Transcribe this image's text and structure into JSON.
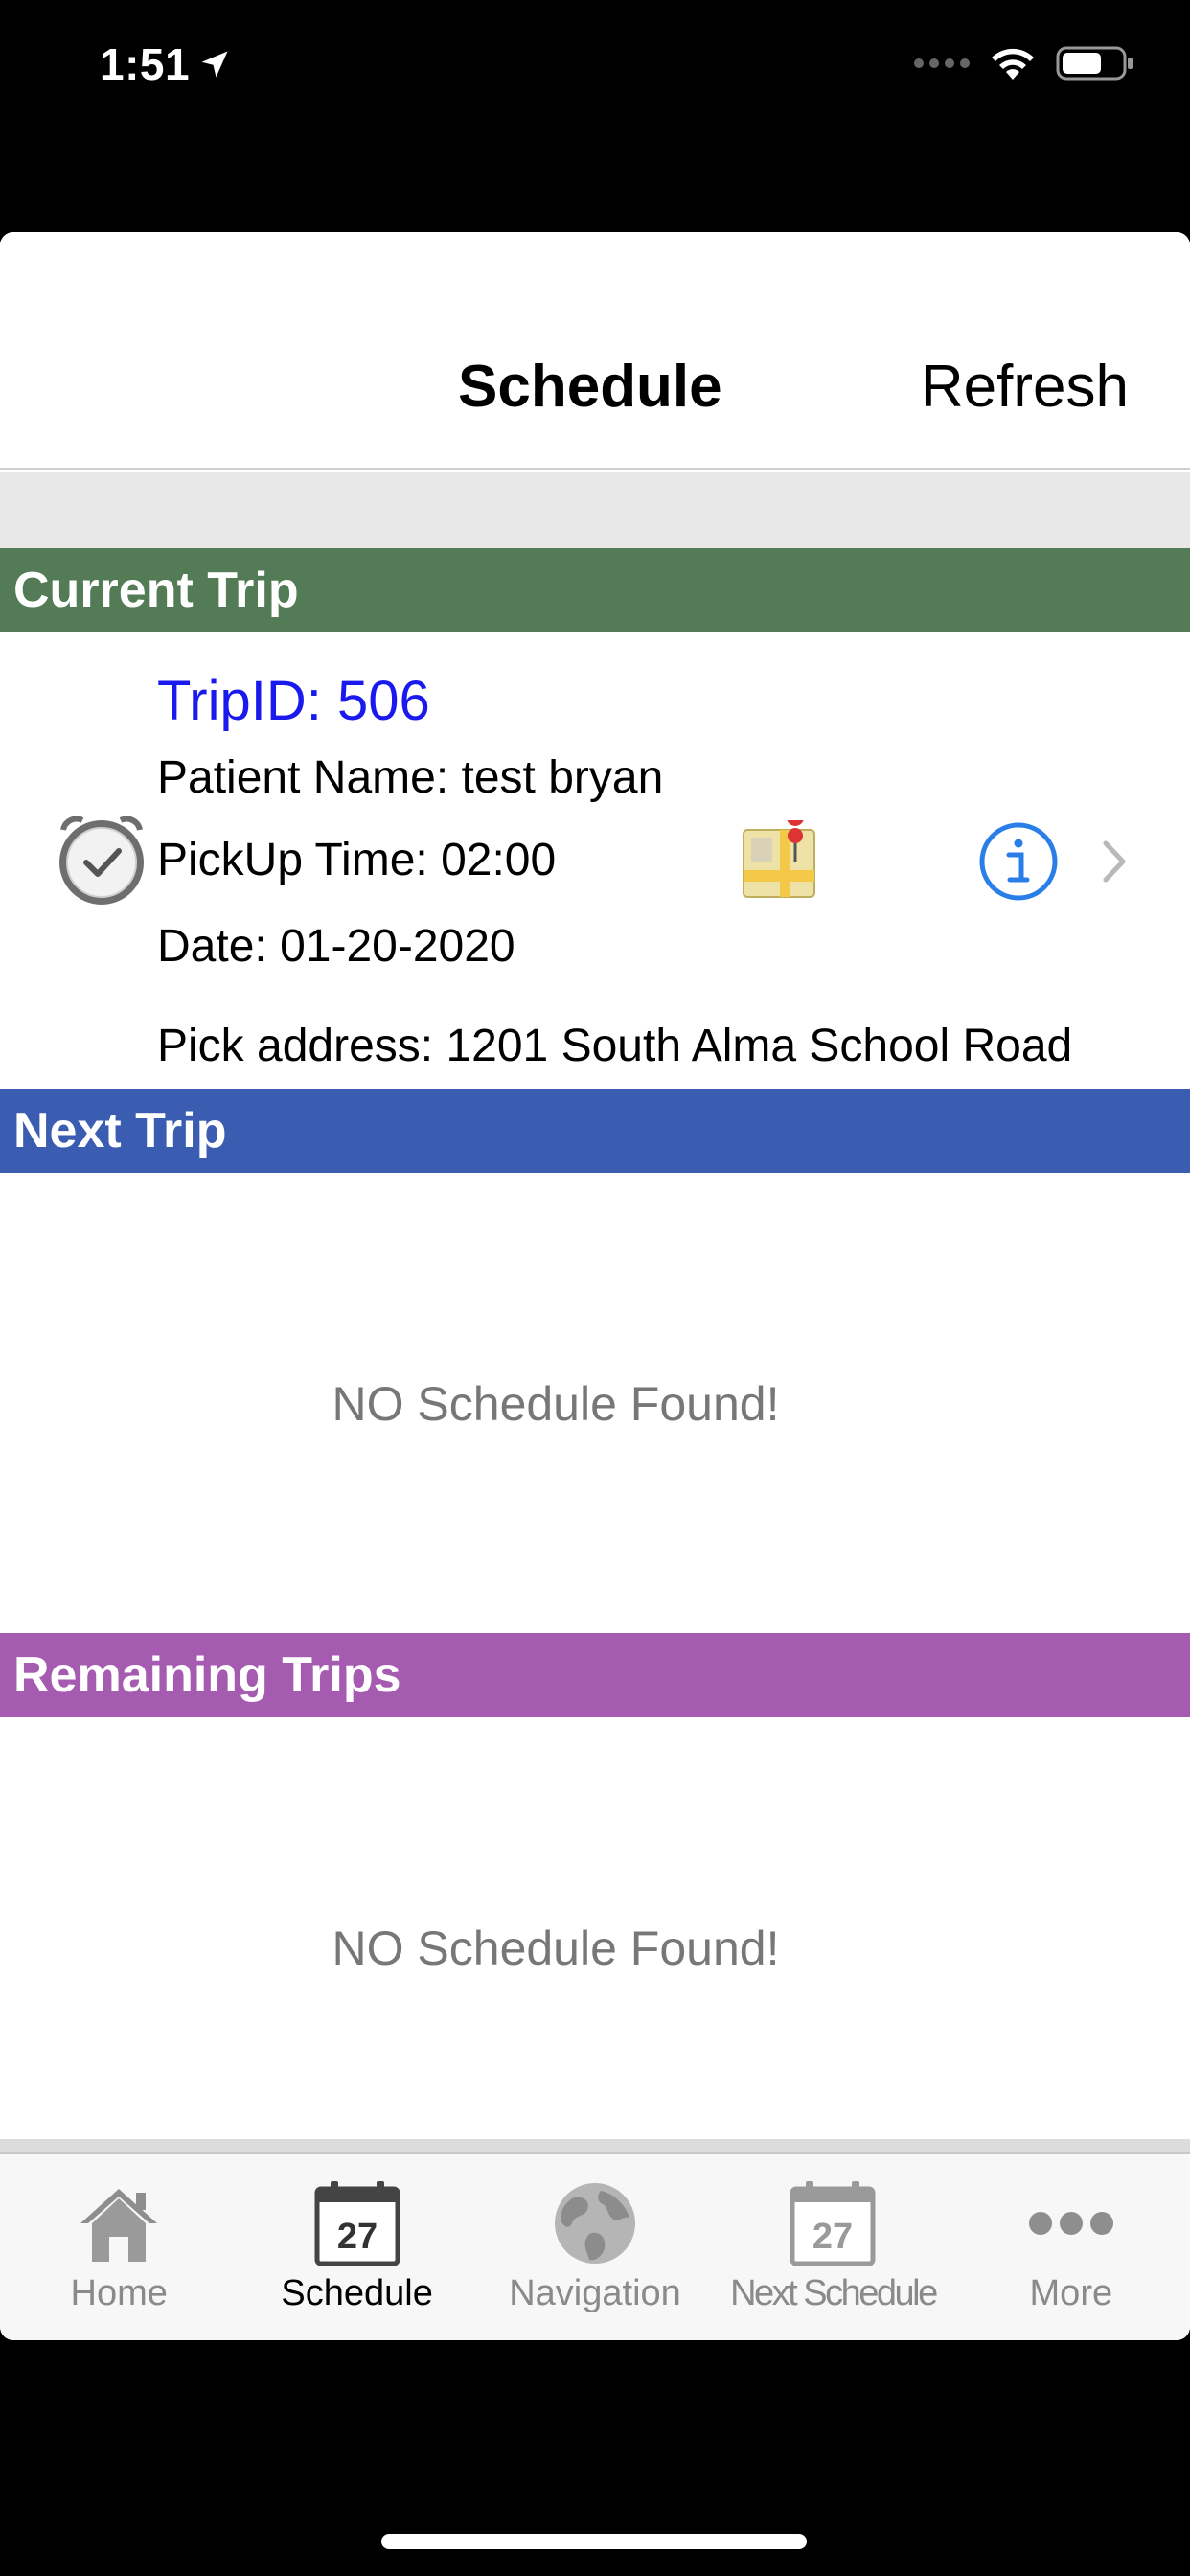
{
  "status_bar": {
    "time": "1:51"
  },
  "nav": {
    "title": "Schedule",
    "refresh_label": "Refresh"
  },
  "sections": {
    "current": {
      "header": "Current Trip",
      "color": "#527b56"
    },
    "next": {
      "header": "Next Trip",
      "color": "#3b5db1",
      "empty_text": "NO Schedule Found!"
    },
    "remaining": {
      "header": "Remaining Trips",
      "color": "#a55bb0",
      "empty_text": "NO Schedule Found!"
    }
  },
  "current_trip": {
    "trip_id": "TripID: 506",
    "patient_name": "Patient Name: test bryan",
    "pickup_time": "PickUp Time: 02:00",
    "date": "Date: 01-20-2020",
    "pick_address": "Pick address: 1201 South Alma School Road",
    "icons": [
      "alarm-clock-icon",
      "map-icon",
      "info-icon",
      "chevron-right-icon"
    ]
  },
  "tab_bar": {
    "active": "schedule",
    "tabs": [
      {
        "id": "home",
        "label": "Home",
        "icon": "house-icon"
      },
      {
        "id": "schedule",
        "label": "Schedule",
        "icon": "calendar-icon",
        "day": "27"
      },
      {
        "id": "navigation",
        "label": "Navigation",
        "icon": "globe-icon"
      },
      {
        "id": "next_schedule",
        "label": "Next Schedule",
        "icon": "calendar-icon",
        "day": "27"
      },
      {
        "id": "more",
        "label": "More",
        "icon": "ellipsis-icon"
      }
    ]
  },
  "colors": {
    "link_blue": "#1a1aee",
    "info_blue": "#2a7ee8"
  }
}
